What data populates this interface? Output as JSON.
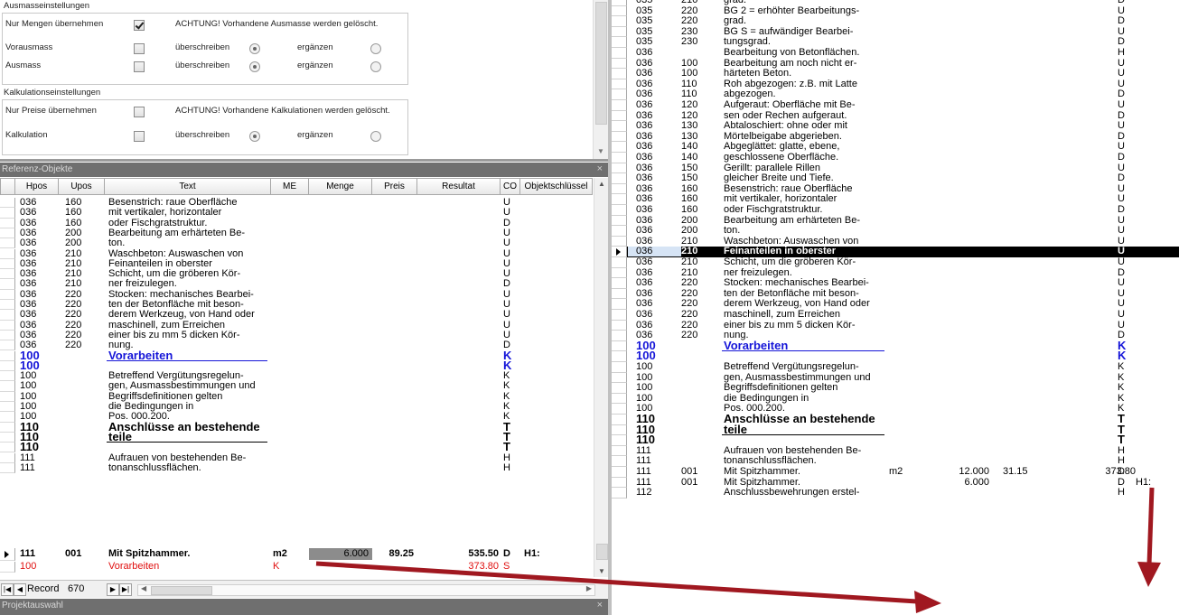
{
  "settings": {
    "ausmasse_title": "Ausmasseinstellungen",
    "kalk_title": "Kalkulationseinstellungen",
    "nur_mengen": "Nur Mengen übernehmen",
    "achtung_ausmasse": "ACHTUNG! Vorhandene Ausmasse werden gelöscht.",
    "vorausmass": "Vorausmass",
    "ausmass": "Ausmass",
    "ueberschreiben": "überschreiben",
    "ergaenzen": "ergänzen",
    "nur_preise": "Nur Preise übernehmen",
    "achtung_kalk": "ACHTUNG! Vorhandene Kalkulationen werden gelöscht.",
    "kalkulation": "Kalkulation"
  },
  "ref_panel": {
    "title": "Referenz-Objekte",
    "close": "×",
    "columns": [
      "Hpos",
      "Upos",
      "Text",
      "ME",
      "Menge",
      "Preis",
      "Resultat",
      "CO",
      "Objektschlüssel"
    ]
  },
  "ref_rows": [
    {
      "hpos": "036",
      "upos": "160",
      "text": "Besenstrich: raue Oberfläche",
      "co": "U"
    },
    {
      "hpos": "036",
      "upos": "160",
      "text": "mit vertikaler, horizontaler",
      "co": "U"
    },
    {
      "hpos": "036",
      "upos": "160",
      "text": "oder Fischgratstruktur.",
      "co": "D"
    },
    {
      "hpos": "036",
      "upos": "200",
      "text": "Bearbeitung am erhärteten Be-",
      "co": "U"
    },
    {
      "hpos": "036",
      "upos": "200",
      "text": "ton.",
      "co": "U"
    },
    {
      "hpos": "036",
      "upos": "210",
      "text": "Waschbeton: Auswaschen von",
      "co": "U"
    },
    {
      "hpos": "036",
      "upos": "210",
      "text": "Feinanteilen in oberster",
      "co": "U"
    },
    {
      "hpos": "036",
      "upos": "210",
      "text": "Schicht, um die gröberen Kör-",
      "co": "U"
    },
    {
      "hpos": "036",
      "upos": "210",
      "text": "ner freizulegen.",
      "co": "D"
    },
    {
      "hpos": "036",
      "upos": "220",
      "text": "Stocken: mechanisches Bearbei-",
      "co": "U"
    },
    {
      "hpos": "036",
      "upos": "220",
      "text": "ten der Betonfläche mit beson-",
      "co": "U"
    },
    {
      "hpos": "036",
      "upos": "220",
      "text": "derem Werkzeug, von Hand oder",
      "co": "U"
    },
    {
      "hpos": "036",
      "upos": "220",
      "text": "maschinell, zum Erreichen",
      "co": "U"
    },
    {
      "hpos": "036",
      "upos": "220",
      "text": "einer bis zu mm 5 dicken Kör-",
      "co": "U"
    },
    {
      "hpos": "036",
      "upos": "220",
      "text": "nung.",
      "co": "D"
    },
    {
      "hpos": "100",
      "upos": "",
      "text": "Vorarbeiten",
      "co": "K",
      "style": "blue"
    },
    {
      "hpos": "100",
      "upos": "",
      "text": "",
      "co": "K",
      "style": "blue"
    },
    {
      "hpos": "100",
      "upos": "",
      "text": "Betreffend Vergütungsregelun-",
      "co": "K"
    },
    {
      "hpos": "100",
      "upos": "",
      "text": "gen, Ausmassbestimmungen und",
      "co": "K"
    },
    {
      "hpos": "100",
      "upos": "",
      "text": "Begriffsdefinitionen gelten",
      "co": "K"
    },
    {
      "hpos": "100",
      "upos": "",
      "text": "die Bedingungen in",
      "co": "K"
    },
    {
      "hpos": "100",
      "upos": "",
      "text": "Pos. 000.200.",
      "co": "K"
    },
    {
      "hpos": "110",
      "upos": "",
      "text": "Anschlüsse an bestehende",
      "co": "T",
      "style": "bold"
    },
    {
      "hpos": "110",
      "upos": "",
      "text": "teile",
      "co": "T",
      "style": "bold"
    },
    {
      "hpos": "110",
      "upos": "",
      "text": "",
      "co": "T",
      "style": "bold"
    },
    {
      "hpos": "111",
      "upos": "",
      "text": "Aufrauen von bestehenden Be-",
      "co": "H"
    },
    {
      "hpos": "111",
      "upos": "",
      "text": "tonanschlussflächen.",
      "co": "H"
    }
  ],
  "ref_selected_row": {
    "hpos": "111",
    "upos": "001",
    "text": "Mit Spitzhammer.",
    "me": "m2",
    "menge": "6.000",
    "preis": "89.25",
    "resultat": "535.50",
    "co": "D",
    "obj": "H1:"
  },
  "ref_red_row": {
    "hpos": "100",
    "text": "Vorarbeiten",
    "me": "K",
    "resultat": "373.80",
    "co": "S"
  },
  "record_bar": {
    "label": "Record",
    "value": "670"
  },
  "projekt_panel": {
    "title": "Projektauswahl",
    "close": "×"
  },
  "right_rows": [
    {
      "hpos": "035",
      "upos": "210",
      "text": "grad.",
      "co": "D"
    },
    {
      "hpos": "035",
      "upos": "220",
      "text": "BG 2 = erhöhter Bearbeitungs-",
      "co": "U"
    },
    {
      "hpos": "035",
      "upos": "220",
      "text": "grad.",
      "co": "D"
    },
    {
      "hpos": "035",
      "upos": "230",
      "text": "BG S = aufwändiger Bearbei-",
      "co": "U"
    },
    {
      "hpos": "035",
      "upos": "230",
      "text": "tungsgrad.",
      "co": "D"
    },
    {
      "hpos": "036",
      "upos": "",
      "text": "Bearbeitung von Betonflächen.",
      "co": "H"
    },
    {
      "hpos": "036",
      "upos": "100",
      "text": "Bearbeitung am noch nicht er-",
      "co": "U"
    },
    {
      "hpos": "036",
      "upos": "100",
      "text": "härteten Beton.",
      "co": "U"
    },
    {
      "hpos": "036",
      "upos": "110",
      "text": "Roh abgezogen: z.B. mit Latte",
      "co": "U"
    },
    {
      "hpos": "036",
      "upos": "110",
      "text": "abgezogen.",
      "co": "D"
    },
    {
      "hpos": "036",
      "upos": "120",
      "text": "Aufgeraut: Oberfläche mit Be-",
      "co": "U"
    },
    {
      "hpos": "036",
      "upos": "120",
      "text": "sen oder Rechen aufgeraut.",
      "co": "D"
    },
    {
      "hpos": "036",
      "upos": "130",
      "text": "Abtaloschiert: ohne oder mit",
      "co": "U"
    },
    {
      "hpos": "036",
      "upos": "130",
      "text": "Mörtelbeigabe abgerieben.",
      "co": "D"
    },
    {
      "hpos": "036",
      "upos": "140",
      "text": "Abgeglättet: glatte, ebene,",
      "co": "U"
    },
    {
      "hpos": "036",
      "upos": "140",
      "text": "geschlossene Oberfläche.",
      "co": "D"
    },
    {
      "hpos": "036",
      "upos": "150",
      "text": "Gerillt: parallele Rillen",
      "co": "U"
    },
    {
      "hpos": "036",
      "upos": "150",
      "text": "gleicher Breite und Tiefe.",
      "co": "D"
    },
    {
      "hpos": "036",
      "upos": "160",
      "text": "Besenstrich: raue Oberfläche",
      "co": "U"
    },
    {
      "hpos": "036",
      "upos": "160",
      "text": "mit vertikaler, horizontaler",
      "co": "U"
    },
    {
      "hpos": "036",
      "upos": "160",
      "text": "oder Fischgratstruktur.",
      "co": "D"
    },
    {
      "hpos": "036",
      "upos": "200",
      "text": "Bearbeitung am erhärteten Be-",
      "co": "U"
    },
    {
      "hpos": "036",
      "upos": "200",
      "text": "ton.",
      "co": "U"
    },
    {
      "hpos": "036",
      "upos": "210",
      "text": "Waschbeton: Auswaschen von",
      "co": "U"
    },
    {
      "hpos": "036",
      "upos": "210",
      "text": "Feinanteilen in oberster",
      "co": "U",
      "style": "hl"
    },
    {
      "hpos": "036",
      "upos": "210",
      "text": "Schicht, um die gröberen Kör-",
      "co": "U"
    },
    {
      "hpos": "036",
      "upos": "210",
      "text": "ner freizulegen.",
      "co": "D"
    },
    {
      "hpos": "036",
      "upos": "220",
      "text": "Stocken: mechanisches Bearbei-",
      "co": "U"
    },
    {
      "hpos": "036",
      "upos": "220",
      "text": "ten der Betonfläche mit beson-",
      "co": "U"
    },
    {
      "hpos": "036",
      "upos": "220",
      "text": "derem Werkzeug, von Hand oder",
      "co": "U"
    },
    {
      "hpos": "036",
      "upos": "220",
      "text": "maschinell, zum Erreichen",
      "co": "U"
    },
    {
      "hpos": "036",
      "upos": "220",
      "text": "einer bis zu mm 5 dicken Kör-",
      "co": "U"
    },
    {
      "hpos": "036",
      "upos": "220",
      "text": "nung.",
      "co": "D"
    },
    {
      "hpos": "100",
      "upos": "",
      "text": "Vorarbeiten",
      "co": "K",
      "style": "blue"
    },
    {
      "hpos": "100",
      "upos": "",
      "text": "",
      "co": "K",
      "style": "blue"
    },
    {
      "hpos": "100",
      "upos": "",
      "text": "Betreffend Vergütungsregelun-",
      "co": "K"
    },
    {
      "hpos": "100",
      "upos": "",
      "text": "gen, Ausmassbestimmungen und",
      "co": "K"
    },
    {
      "hpos": "100",
      "upos": "",
      "text": "Begriffsdefinitionen gelten",
      "co": "K"
    },
    {
      "hpos": "100",
      "upos": "",
      "text": "die Bedingungen in",
      "co": "K"
    },
    {
      "hpos": "100",
      "upos": "",
      "text": "Pos. 000.200.",
      "co": "K"
    },
    {
      "hpos": "110",
      "upos": "",
      "text": "Anschlüsse an bestehende",
      "co": "T",
      "style": "bold"
    },
    {
      "hpos": "110",
      "upos": "",
      "text": "teile",
      "co": "T",
      "style": "bold"
    },
    {
      "hpos": "110",
      "upos": "",
      "text": "",
      "co": "T",
      "style": "bold"
    },
    {
      "hpos": "111",
      "upos": "",
      "text": "Aufrauen von bestehenden Be-",
      "co": "H"
    },
    {
      "hpos": "111",
      "upos": "",
      "text": "tonanschlussflächen.",
      "co": "H"
    },
    {
      "hpos": "111",
      "upos": "001",
      "text": "Mit Spitzhammer.",
      "me": "m2",
      "menge": "12.000",
      "preis": "31.15",
      "resultat": "373.80",
      "co": "D"
    },
    {
      "hpos": "111",
      "upos": "001",
      "text": "Mit Spitzhammer.",
      "menge": "6.000",
      "co": "D",
      "obj": "H1:"
    },
    {
      "hpos": "112",
      "upos": "",
      "text": "Anschlussbewehrungen erstel-",
      "co": "H"
    }
  ],
  "colors": {
    "arrow": "#a01820",
    "highlight": "#000000",
    "selected_hpos": "#d6e4f5",
    "blue_text": "#1515d8",
    "red_text": "#e01010"
  }
}
